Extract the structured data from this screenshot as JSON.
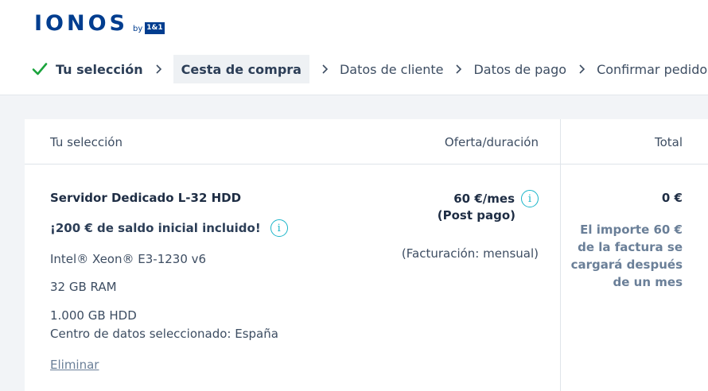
{
  "brand": {
    "logo_word": "IONOS",
    "logo_by": "by",
    "logo_brand": "1&1"
  },
  "steps": [
    {
      "label": "Tu selección",
      "state": "done"
    },
    {
      "label": "Cesta de compra",
      "state": "active"
    },
    {
      "label": "Datos de cliente",
      "state": "pending"
    },
    {
      "label": "Datos de pago",
      "state": "pending"
    },
    {
      "label": "Confirmar pedido",
      "state": "pending"
    }
  ],
  "table": {
    "headers": {
      "selection": "Tu selección",
      "offer": "Oferta/duración",
      "total": "Total"
    }
  },
  "product": {
    "name": "Servidor Dedicado L-32 HDD",
    "promo": "¡200 € de saldo inicial incluido!",
    "specs": {
      "cpu": "Intel® Xeon® E3-1230 v6",
      "ram": "32 GB RAM",
      "hdd": "1.000 GB HDD",
      "datacenter": "Centro de datos seleccionado: España"
    },
    "remove_label": "Eliminar",
    "price": "60 €/mes",
    "price_type": "(Post pago)",
    "billing": "(Facturación: mensual)",
    "total": "0 €",
    "total_note": "El importe 60 € de la factura se cargará después de un mes"
  },
  "icons": {
    "check": "check-icon",
    "separator": "chevron-right-icon",
    "info": "info-icon"
  },
  "colors": {
    "brand": "#003d8f",
    "check": "#1aa33c",
    "info": "#1ab5c9",
    "link": "#6a7f98"
  }
}
